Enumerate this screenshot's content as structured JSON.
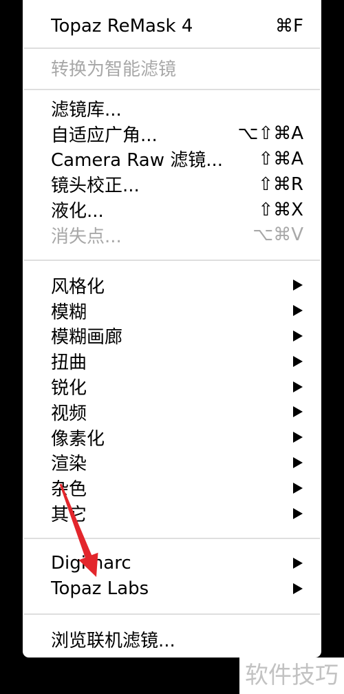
{
  "colors": {
    "background": "#000000",
    "menu_background": "#ffffff",
    "text": "#000000",
    "disabled_text": "#a8a8a8",
    "separator": "#dedede",
    "annotation_arrow": "#e3262c",
    "watermark_background": "#ffffff",
    "watermark_text": "#c2c2c2"
  },
  "menu": {
    "submenu_icon": "submenu-arrow-icon",
    "groups": [
      {
        "items": [
          {
            "label": "Topaz ReMask 4",
            "shortcut": "⌘F"
          }
        ]
      },
      {
        "items": [
          {
            "label": "转换为智能滤镜",
            "enabled": false
          }
        ]
      },
      {
        "items": [
          {
            "label": "滤镜库..."
          },
          {
            "label": "自适应广角...",
            "shortcut": "⌥⇧⌘A"
          },
          {
            "label": "Camera Raw 滤镜...",
            "shortcut": "⇧⌘A"
          },
          {
            "label": "镜头校正...",
            "shortcut": "⇧⌘R"
          },
          {
            "label": "液化...",
            "shortcut": "⇧⌘X"
          },
          {
            "label": "消失点...",
            "shortcut": "⌥⌘V",
            "enabled": false
          }
        ]
      },
      {
        "items": [
          {
            "label": "风格化",
            "submenu": true
          },
          {
            "label": "模糊",
            "submenu": true
          },
          {
            "label": "模糊画廊",
            "submenu": true
          },
          {
            "label": "扭曲",
            "submenu": true
          },
          {
            "label": "锐化",
            "submenu": true
          },
          {
            "label": "视频",
            "submenu": true
          },
          {
            "label": "像素化",
            "submenu": true
          },
          {
            "label": "渲染",
            "submenu": true
          },
          {
            "label": "杂色",
            "submenu": true
          },
          {
            "label": "其它",
            "submenu": true
          }
        ]
      },
      {
        "items": [
          {
            "label": "Digimarc",
            "submenu": true
          },
          {
            "label": "Topaz Labs",
            "submenu": true
          }
        ]
      },
      {
        "items": [
          {
            "label": "浏览联机滤镜..."
          }
        ]
      }
    ]
  },
  "watermark": {
    "text": "软件技巧"
  }
}
